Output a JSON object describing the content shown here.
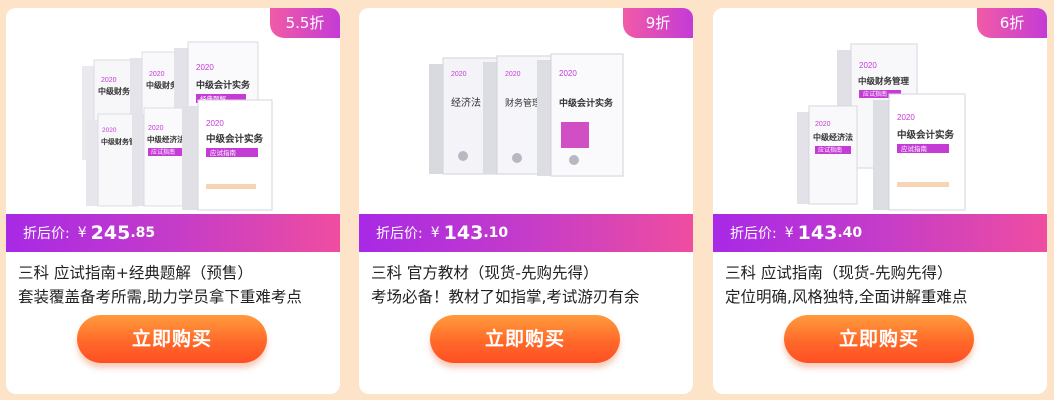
{
  "products": [
    {
      "discount": "5.5折",
      "price_label": "折后价:",
      "currency": "¥",
      "price_int": "245",
      "price_dec": ".85",
      "title": "三科 应试指南+经典题解（预售）",
      "desc": "套装覆盖备考所需,助力学员拿下重难考点",
      "buy_label": "立即购买",
      "book_titles": [
        "中级会计实务",
        "中级会计实务",
        "中级财务管理",
        "中级经济法"
      ],
      "book_tags": [
        "经典题解",
        "应试指南"
      ],
      "book_year": "2020"
    },
    {
      "discount": "9折",
      "price_label": "折后价:",
      "currency": "¥",
      "price_int": "143",
      "price_dec": ".10",
      "title": "三科 官方教材（现货-先购先得）",
      "desc": "考场必备！教材了如指掌,考试游刃有余",
      "buy_label": "立即购买",
      "book_titles": [
        "经济法",
        "财务管理",
        "中级会计实务"
      ],
      "book_year": "2020"
    },
    {
      "discount": "6折",
      "price_label": "折后价:",
      "currency": "¥",
      "price_int": "143",
      "price_dec": ".40",
      "title": "三科 应试指南（现货-先购先得）",
      "desc": "定位明确,风格独特,全面讲解重难点",
      "buy_label": "立即购买",
      "book_titles": [
        "中级财务管理",
        "中级经济法",
        "中级会计实务"
      ],
      "book_tags": [
        "应试指南"
      ],
      "book_year": "2020"
    }
  ],
  "colors": {
    "page_bg": "#fde3c8",
    "price_bar_start": "#a829e6",
    "price_bar_end": "#ef4da0",
    "tag_start": "#f15ba6",
    "tag_end": "#c43bd6",
    "button_top": "#ff9b3c",
    "button_bottom": "#ff4e24"
  }
}
